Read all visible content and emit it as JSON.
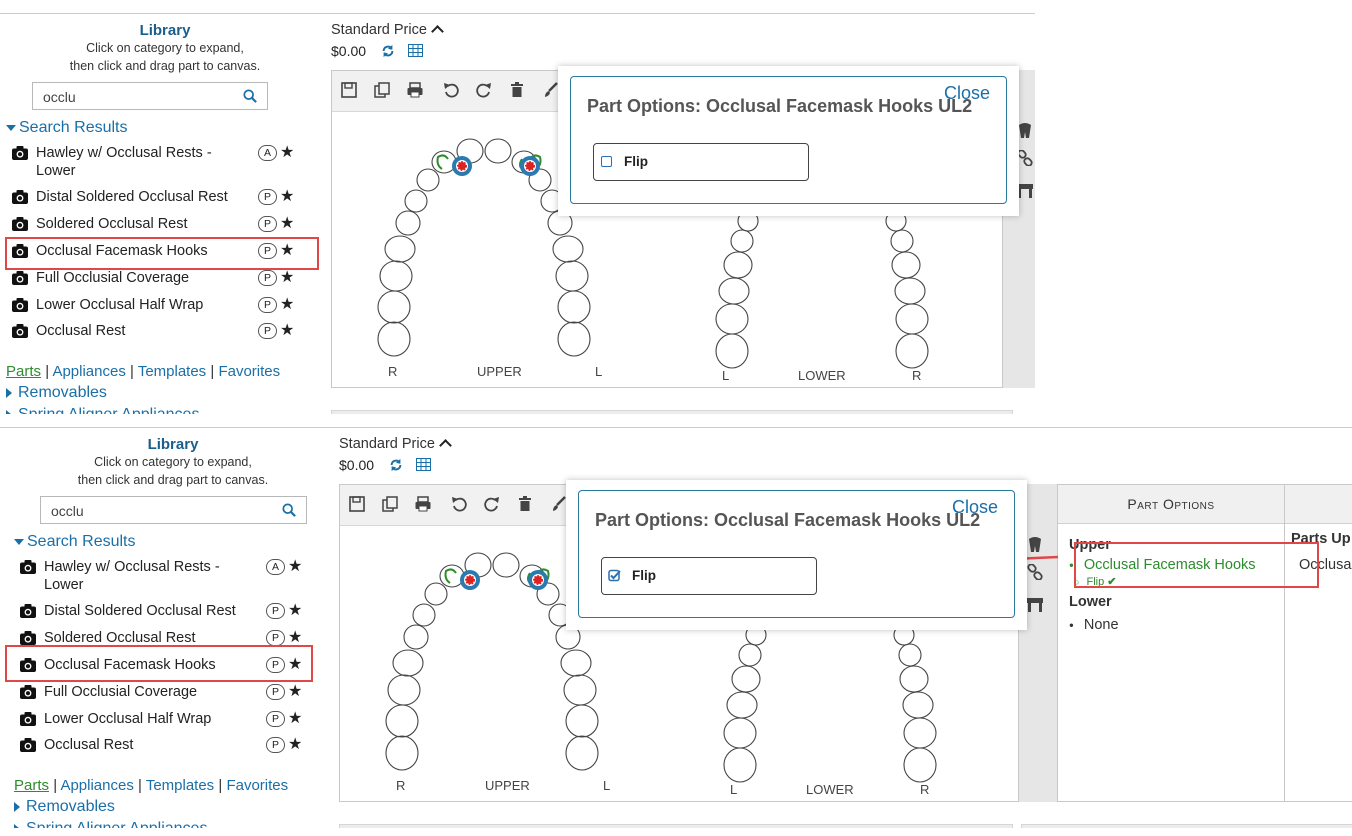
{
  "library": {
    "title": "Library",
    "instruction_1": "Click on category to expand,",
    "instruction_2": "then click and drag part to canvas.",
    "search_value": "occlu",
    "search_results_label": "Search Results",
    "results": [
      {
        "name": "Hawley w/ Occlusal Rests - Lower",
        "badge": "A"
      },
      {
        "name": "Distal Soldered Occlusal Rest",
        "badge": "P"
      },
      {
        "name": "Soldered Occlusal Rest",
        "badge": "P"
      },
      {
        "name": "Occlusal Facemask Hooks",
        "badge": "P"
      },
      {
        "name": "Full Occlusial Coverage",
        "badge": "P"
      },
      {
        "name": "Lower Occlusal Half Wrap",
        "badge": "P"
      },
      {
        "name": "Occlusal Rest",
        "badge": "P"
      }
    ],
    "star_glyph": "★",
    "nav_links": {
      "parts": "Parts",
      "appliances": "Appliances",
      "templates": "Templates",
      "favorites": "Favorites",
      "separator": "|"
    },
    "categories": [
      "Removables",
      "Spring Aligner Appliances"
    ]
  },
  "price": {
    "label": "Standard Price",
    "value": "$0.00"
  },
  "canvas_labels": {
    "upper": "UPPER",
    "lower": "LOWER",
    "r": "R",
    "l": "L"
  },
  "modal": {
    "title": "Part Options: Occlusal Facemask Hooks UL2",
    "close": "Close",
    "flip_label": "Flip"
  },
  "part_options_panel": {
    "header": "Part Options",
    "upper_label": "Upper",
    "upper_item": "Occlusal Facemask Hooks",
    "flip_note": "Flip",
    "lower_label": "Lower",
    "lower_item": "None",
    "parts_up_label": "Parts Up",
    "parts_up_item": "Occlusa"
  },
  "colors": {
    "accent": "#1a6fa8",
    "title": "#1a5f8c",
    "highlight_red": "#e04848",
    "selected_green": "#2e8b2e",
    "modal_border": "#2a7a9a"
  }
}
